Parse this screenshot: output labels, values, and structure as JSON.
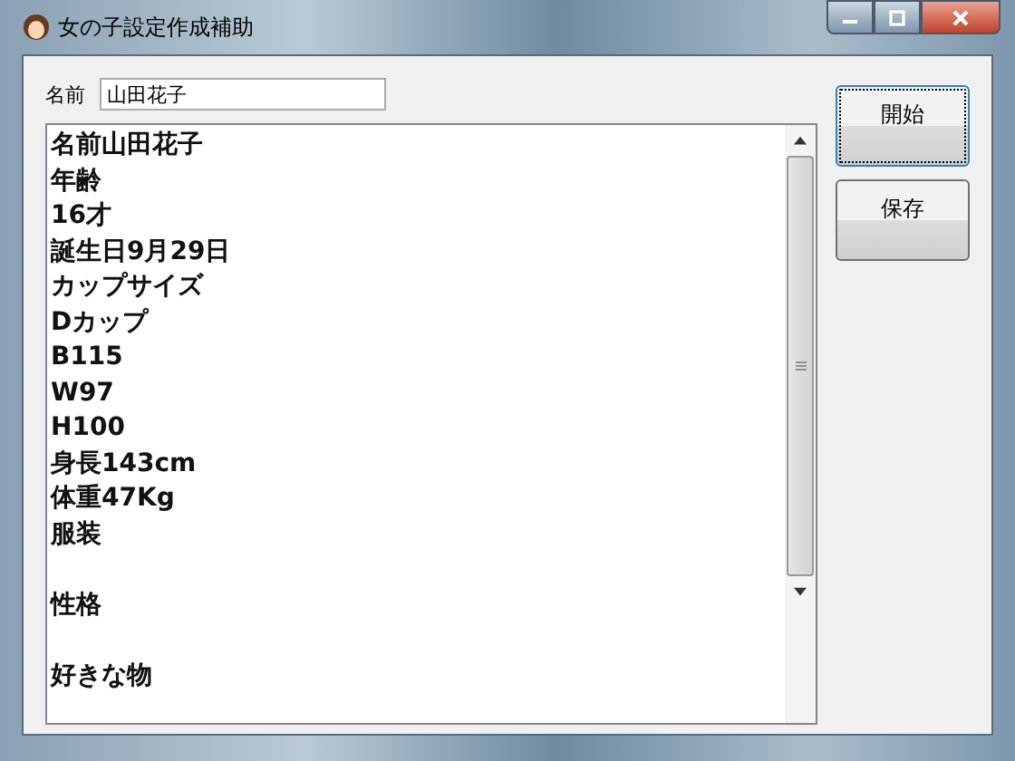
{
  "window": {
    "title": "女の子設定作成補助"
  },
  "name_field": {
    "label": "名前",
    "value": "山田花子"
  },
  "text_area": {
    "paragraphs": [
      [
        "名前山田花子",
        "年齢",
        "16才",
        "誕生日9月29日",
        "カップサイズ",
        "Dカップ",
        "B115",
        "W97",
        "H100",
        "身長143cm",
        "体重47Kg",
        "服装"
      ],
      [
        "性格"
      ],
      [
        "好きな物"
      ]
    ]
  },
  "buttons": [
    {
      "label": "開始",
      "focused": true
    },
    {
      "label": "保存",
      "focused": false
    }
  ]
}
